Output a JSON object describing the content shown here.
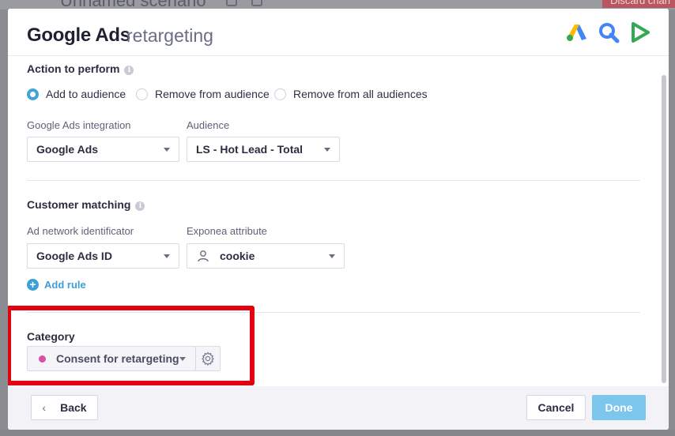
{
  "background": {
    "scenario_title": "Unnamed scenario",
    "discard_label": "Discard chan"
  },
  "header": {
    "title_main": "Google Ads",
    "title_sub": "retargeting",
    "icons": [
      "google-ads-icon",
      "search-ads-icon",
      "google-play-icon"
    ]
  },
  "action": {
    "label": "Action to perform",
    "options": [
      {
        "label": "Add to audience",
        "selected": true
      },
      {
        "label": "Remove from audience",
        "selected": false
      },
      {
        "label": "Remove from all audiences",
        "selected": false
      }
    ]
  },
  "integration": {
    "label": "Google Ads integration",
    "value": "Google Ads"
  },
  "audience": {
    "label": "Audience",
    "value": "LS - Hot Lead - Total"
  },
  "customer_matching": {
    "label": "Customer matching",
    "identificator_label": "Ad network identificator",
    "identificator_value": "Google Ads ID",
    "attribute_label": "Exponea attribute",
    "attribute_value": "cookie",
    "add_rule_label": "Add rule"
  },
  "category": {
    "label": "Category",
    "value": "Consent for retargeting",
    "dot_color": "#d94fa6"
  },
  "footer": {
    "back_label": "Back",
    "cancel_label": "Cancel",
    "done_label": "Done"
  },
  "colors": {
    "accent": "#43a3d6",
    "highlight": "#e3000f",
    "done_button": "#7cc6ec"
  }
}
